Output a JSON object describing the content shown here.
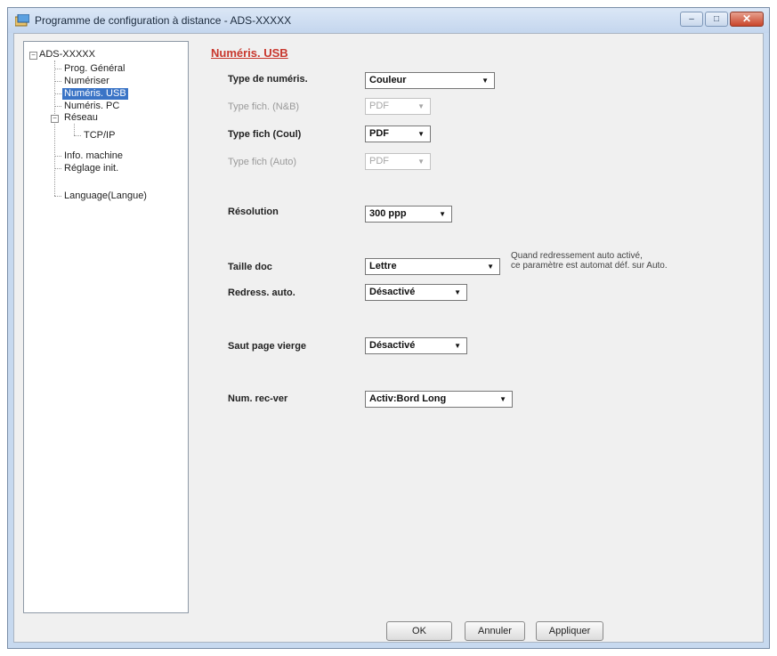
{
  "window": {
    "title": "Programme de configuration à distance - ADS-XXXXX",
    "minimize": "–",
    "maximize": "□",
    "close": "✕"
  },
  "tree": {
    "root": "ADS-XXXXX",
    "items": [
      "Prog. Général",
      "Numériser",
      "Numéris. USB",
      "Numéris. PC",
      "Réseau",
      "TCP/IP",
      "Info. machine",
      "Réglage init.",
      "Language(Langue)"
    ],
    "selected": "Numéris. USB"
  },
  "panel": {
    "title": "Numéris. USB",
    "fields": [
      {
        "label": "Type de numéris.",
        "value": "Couleur",
        "disabled": false
      },
      {
        "label": "Type fich. (N&B)",
        "value": "PDF",
        "disabled": true
      },
      {
        "label": "Type fich (Coul)",
        "value": "PDF",
        "disabled": false
      },
      {
        "label": "Type fich (Auto)",
        "value": "PDF",
        "disabled": true
      },
      {
        "label": "Résolution",
        "value": "300 ppp",
        "disabled": false
      },
      {
        "label": "Taille doc",
        "value": "Lettre",
        "disabled": false
      },
      {
        "label": "Redress. auto.",
        "value": "Désactivé",
        "disabled": false
      },
      {
        "label": "Saut page vierge",
        "value": "Désactivé",
        "disabled": false
      },
      {
        "label": "Num. rec-ver",
        "value": "Activ:Bord Long",
        "disabled": false
      }
    ],
    "note_line1": "Quand redressement auto activé,",
    "note_line2": "ce paramètre est automat déf. sur Auto."
  },
  "buttons": {
    "ok": "OK",
    "cancel": "Annuler",
    "apply": "Appliquer"
  }
}
